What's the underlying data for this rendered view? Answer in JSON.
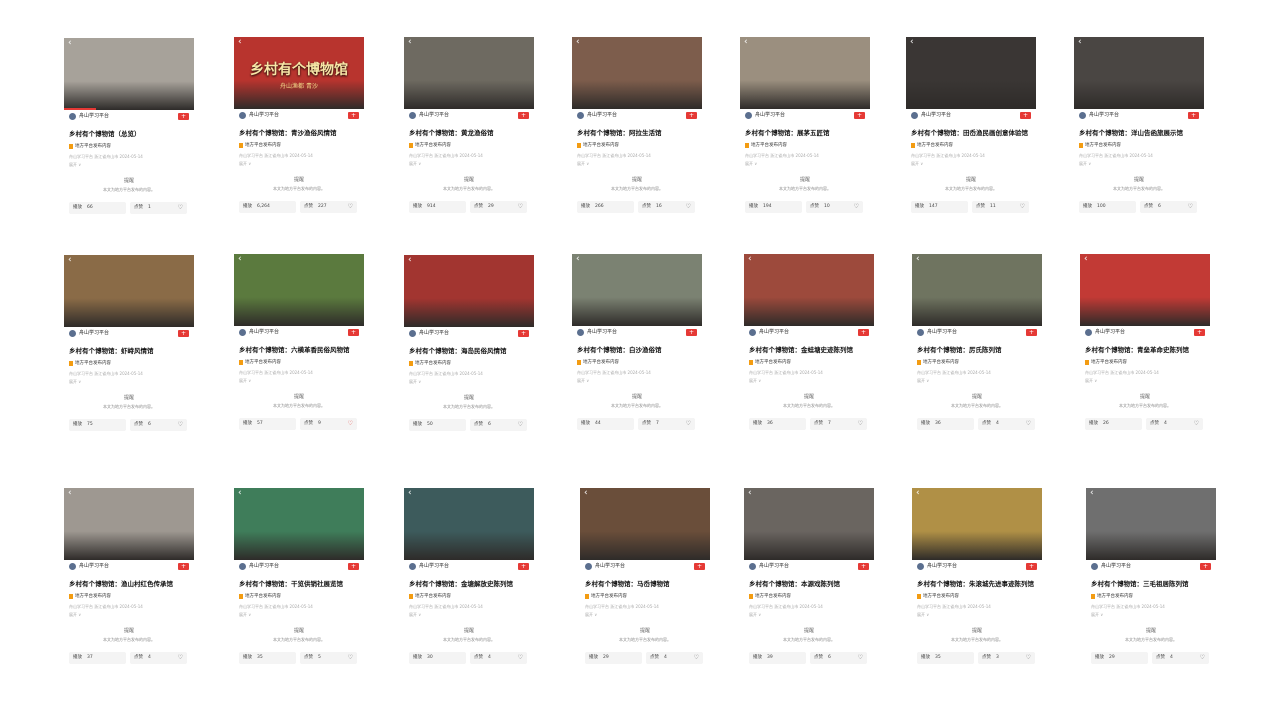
{
  "common": {
    "publisher": "舟山学习平台",
    "follow_icon": "plus-icon",
    "source_label": "地方平台发布内容",
    "meta_line": "舟山学习平台 浙江省舟山市  2024-05-14",
    "more_label": "展开 ∨",
    "hint_title": "提醒",
    "hint_text": "本文为地方平台发布的内容。",
    "play_label": "播放",
    "like_label": "点赞",
    "back_icon": "‹",
    "like_icon": "👍"
  },
  "cards": [
    {
      "title": "乡村有个博物馆（总览）",
      "plays": "66",
      "likes": "1",
      "thumb_color": "#a7a29a",
      "thumb_overlay": "",
      "thumb_overlay_sub": ""
    },
    {
      "title": "乡村有个博物馆：青沙渔俗风情馆",
      "plays": "6,264",
      "likes": "227",
      "thumb_color": "#b8342e",
      "thumb_overlay": "乡村有个博物馆",
      "thumb_overlay_sub": "舟山渔都 青沙"
    },
    {
      "title": "乡村有个博物馆：黄龙渔俗馆",
      "plays": "914",
      "likes": "29",
      "thumb_color": "#6e6a61",
      "thumb_overlay": "",
      "thumb_overlay_sub": ""
    },
    {
      "title": "乡村有个博物馆：阿拉生活馆",
      "plays": "266",
      "likes": "16",
      "thumb_color": "#7d5d4c",
      "thumb_overlay": "",
      "thumb_overlay_sub": ""
    },
    {
      "title": "乡村有个博物馆：展茅五匠馆",
      "plays": "194",
      "likes": "10",
      "thumb_color": "#9b8f7f",
      "thumb_overlay": "",
      "thumb_overlay_sub": ""
    },
    {
      "title": "乡村有个博物馆：田岙渔民画创意体验馆",
      "plays": "147",
      "likes": "11",
      "thumb_color": "#3a3634",
      "thumb_overlay": "",
      "thumb_overlay_sub": ""
    },
    {
      "title": "乡村有个博物馆：洋山告函旅展示馆",
      "plays": "100",
      "likes": "6",
      "thumb_color": "#4a4643",
      "thumb_overlay": "",
      "thumb_overlay_sub": ""
    },
    {
      "title": "乡村有个博物馆：虾峙风情馆",
      "plays": "75",
      "likes": "6",
      "thumb_color": "#8a6b47",
      "thumb_overlay": "",
      "thumb_overlay_sub": ""
    },
    {
      "title": "乡村有个博物馆：六横革香民俗风物馆",
      "plays": "57",
      "likes": "9",
      "thumb_color": "#5b7a3e",
      "thumb_overlay": "",
      "thumb_overlay_sub": ""
    },
    {
      "title": "乡村有个博物馆：海岛民俗风情馆",
      "plays": "50",
      "likes": "6",
      "thumb_color": "#a23530",
      "thumb_overlay": "",
      "thumb_overlay_sub": ""
    },
    {
      "title": "乡村有个博物馆：白沙渔俗馆",
      "plays": "44",
      "likes": "7",
      "thumb_color": "#7b8272",
      "thumb_overlay": "",
      "thumb_overlay_sub": ""
    },
    {
      "title": "乡村有个博物馆：金蛙塘史迹陈列馆",
      "plays": "36",
      "likes": "7",
      "thumb_color": "#9d4a3c",
      "thumb_overlay": "",
      "thumb_overlay_sub": ""
    },
    {
      "title": "乡村有个博物馆：厉氏陈列馆",
      "plays": "36",
      "likes": "4",
      "thumb_color": "#6f7460",
      "thumb_overlay": "",
      "thumb_overlay_sub": ""
    },
    {
      "title": "乡村有个博物馆：青垒革命史陈列馆",
      "plays": "26",
      "likes": "4",
      "thumb_color": "#c23a35",
      "thumb_overlay": "",
      "thumb_overlay_sub": ""
    },
    {
      "title": "乡村有个博物馆：渔山村红色传承馆",
      "plays": "37",
      "likes": "4",
      "thumb_color": "#9e9891",
      "thumb_overlay": "",
      "thumb_overlay_sub": ""
    },
    {
      "title": "乡村有个博物馆：干览供销社展览馆",
      "plays": "35",
      "likes": "5",
      "thumb_color": "#3f7d5a",
      "thumb_overlay": "",
      "thumb_overlay_sub": ""
    },
    {
      "title": "乡村有个博物馆：金塘解放史陈列馆",
      "plays": "30",
      "likes": "4",
      "thumb_color": "#3d5b5c",
      "thumb_overlay": "",
      "thumb_overlay_sub": ""
    },
    {
      "title": "乡村有个博物馆：马岙博物馆",
      "plays": "29",
      "likes": "4",
      "thumb_color": "#6a4e3a",
      "thumb_overlay": "",
      "thumb_overlay_sub": ""
    },
    {
      "title": "乡村有个博物馆：本源戏陈列馆",
      "plays": "39",
      "likes": "6",
      "thumb_color": "#6a6560",
      "thumb_overlay": "",
      "thumb_overlay_sub": ""
    },
    {
      "title": "乡村有个博物馆：朱滚城先进事迹陈列馆",
      "plays": "35",
      "likes": "3",
      "thumb_color": "#b09046",
      "thumb_overlay": "",
      "thumb_overlay_sub": ""
    },
    {
      "title": "乡村有个博物馆：三毛祖居陈列馆",
      "plays": "29",
      "likes": "4",
      "thumb_color": "#6f6f6f",
      "thumb_overlay": "",
      "thumb_overlay_sub": ""
    }
  ]
}
